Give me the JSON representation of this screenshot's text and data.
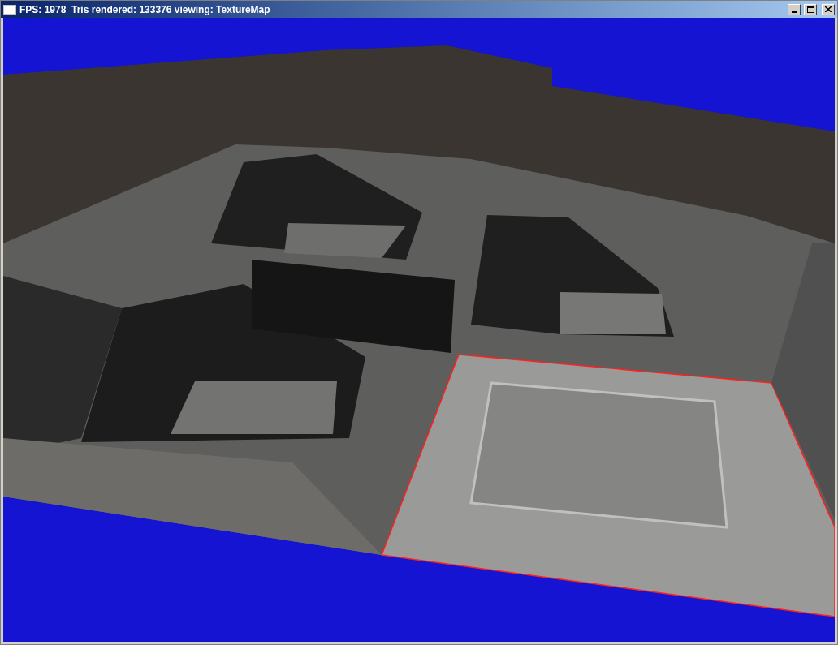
{
  "window": {
    "title": "FPS: 1978  Tris rendered: 133376 viewing: TextureMap"
  }
}
